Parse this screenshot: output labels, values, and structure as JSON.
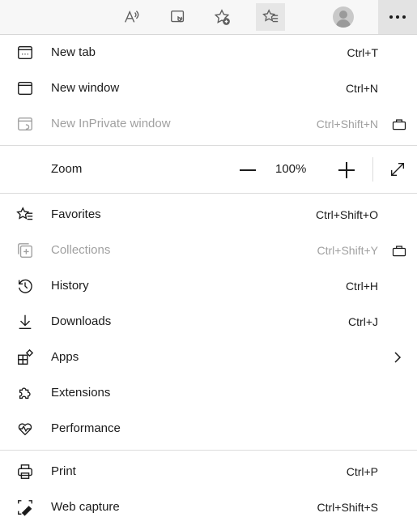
{
  "toolbar": {
    "buttons": [
      {
        "name": "read-aloud-icon"
      },
      {
        "name": "immersive-reader-icon"
      },
      {
        "name": "add-favorite-icon"
      },
      {
        "name": "favorites-icon"
      },
      {
        "name": "profile-avatar"
      },
      {
        "name": "more-icon"
      }
    ]
  },
  "menu": {
    "new_tab": {
      "label": "New tab",
      "shortcut": "Ctrl+T"
    },
    "new_window": {
      "label": "New window",
      "shortcut": "Ctrl+N"
    },
    "new_inprivate": {
      "label": "New InPrivate window",
      "shortcut": "Ctrl+Shift+N"
    },
    "zoom": {
      "label": "Zoom",
      "value": "100%"
    },
    "favorites": {
      "label": "Favorites",
      "shortcut": "Ctrl+Shift+O"
    },
    "collections": {
      "label": "Collections",
      "shortcut": "Ctrl+Shift+Y"
    },
    "history": {
      "label": "History",
      "shortcut": "Ctrl+H"
    },
    "downloads": {
      "label": "Downloads",
      "shortcut": "Ctrl+J"
    },
    "apps": {
      "label": "Apps"
    },
    "extensions": {
      "label": "Extensions"
    },
    "performance": {
      "label": "Performance"
    },
    "print": {
      "label": "Print",
      "shortcut": "Ctrl+P"
    },
    "web_capture": {
      "label": "Web capture",
      "shortcut": "Ctrl+Shift+S"
    }
  },
  "colors": {
    "text": "#1b1b1b",
    "disabled": "#a0a0a0",
    "toolbar_bg": "#f7f7f7"
  }
}
